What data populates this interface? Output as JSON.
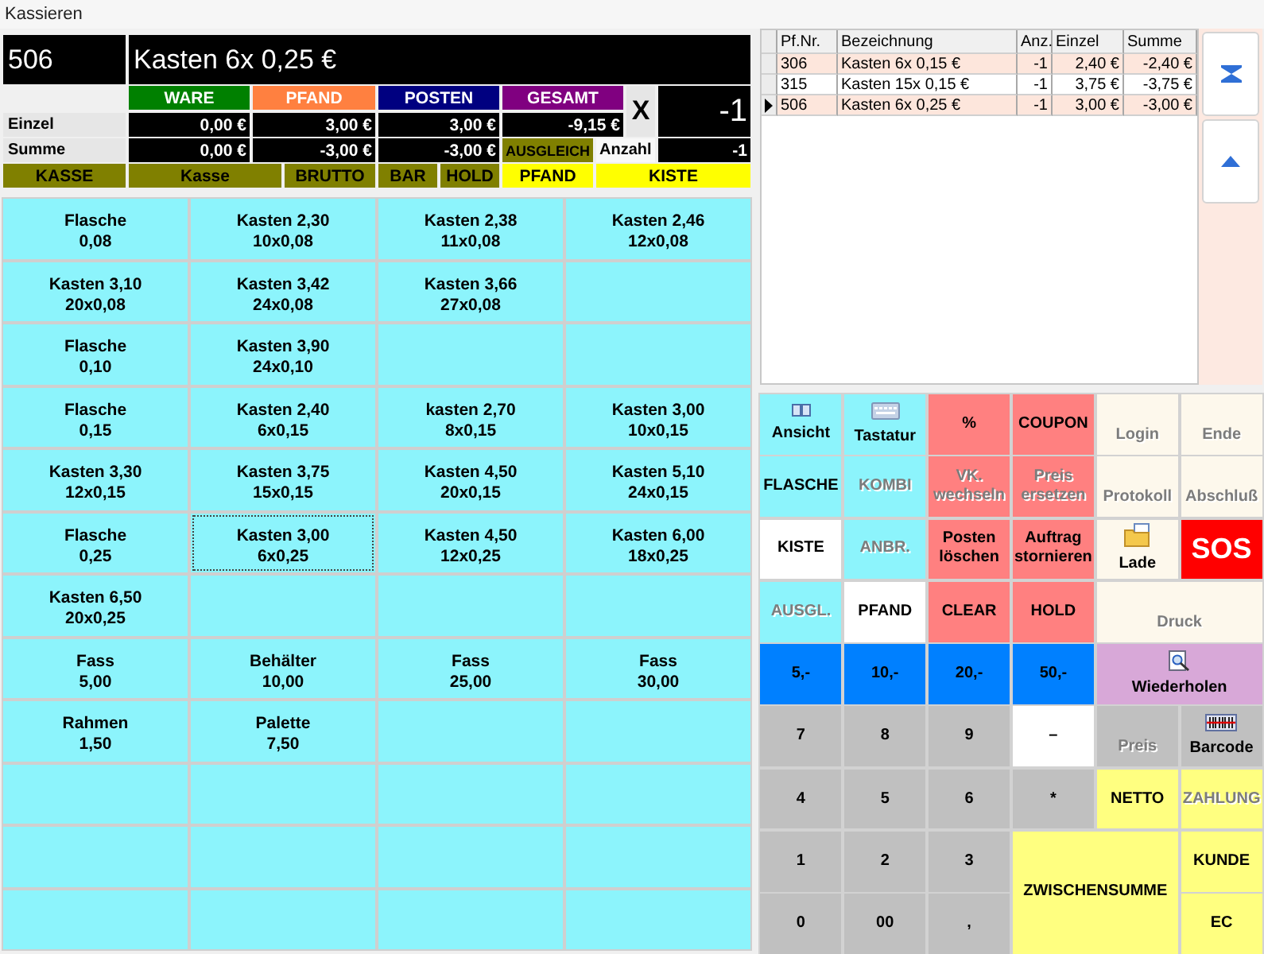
{
  "window": {
    "title": "Kassieren"
  },
  "display": {
    "code": "506",
    "text": "Kasten 6x 0,25 €"
  },
  "totals": {
    "columns": [
      {
        "label": "WARE",
        "color": "#008000"
      },
      {
        "label": "PFAND",
        "color": "#ff8040"
      },
      {
        "label": "POSTEN",
        "color": "#000080"
      },
      {
        "label": "GESAMT",
        "color": "#800080"
      }
    ],
    "rows": [
      {
        "label": "Einzel",
        "values": [
          "0,00 €",
          "3,00 €",
          "3,00 €",
          "-9,15 €"
        ]
      },
      {
        "label": "Summe",
        "values": [
          "0,00 €",
          "-3,00 €",
          "-3,00 €"
        ]
      }
    ],
    "multiply_sign": "X",
    "quantity": "-1",
    "balance_label": "AUSGLEICH",
    "count_label": "Anzahl",
    "count_value": "-1"
  },
  "status_bar": [
    {
      "label": "KASSE",
      "color": "#808000"
    },
    {
      "label": "Kasse",
      "color": "#808000"
    },
    {
      "label": "BRUTTO",
      "color": "#808000"
    },
    {
      "label": "BAR",
      "color": "#808000"
    },
    {
      "label": "HOLD",
      "color": "#808000"
    },
    {
      "label": "PFAND",
      "color": "#ffff00"
    },
    {
      "label": "KISTE",
      "color": "#ffff00"
    }
  ],
  "articles": [
    {
      "name": "Flasche",
      "detail": "0,08",
      "selected": false
    },
    {
      "name": "Kasten 2,30",
      "detail": "10x0,08",
      "selected": false
    },
    {
      "name": "Kasten 2,38",
      "detail": "11x0,08",
      "selected": false
    },
    {
      "name": "Kasten 2,46",
      "detail": "12x0,08",
      "selected": false
    },
    {
      "name": "Kasten 3,10",
      "detail": "20x0,08",
      "selected": false
    },
    {
      "name": "Kasten 3,42",
      "detail": "24x0,08",
      "selected": false
    },
    {
      "name": "Kasten 3,66",
      "detail": "27x0,08",
      "selected": false
    },
    {
      "selected": false
    },
    {
      "name": "Flasche",
      "detail": "0,10",
      "selected": false
    },
    {
      "name": "Kasten 3,90",
      "detail": "24x0,10",
      "selected": false
    },
    {
      "selected": false
    },
    {
      "selected": false
    },
    {
      "name": "Flasche",
      "detail": "0,15",
      "selected": false
    },
    {
      "name": "Kasten 2,40",
      "detail": "6x0,15",
      "selected": false
    },
    {
      "name": "kasten 2,70",
      "detail": "8x0,15",
      "selected": false
    },
    {
      "name": "Kasten 3,00",
      "detail": "10x0,15",
      "selected": false
    },
    {
      "name": "Kasten 3,30",
      "detail": "12x0,15",
      "selected": false
    },
    {
      "name": "Kasten 3,75",
      "detail": "15x0,15",
      "selected": false
    },
    {
      "name": "Kasten 4,50",
      "detail": "20x0,15",
      "selected": false
    },
    {
      "name": "Kasten 5,10",
      "detail": "24x0,15",
      "selected": false
    },
    {
      "name": "Flasche",
      "detail": "0,25",
      "selected": false
    },
    {
      "name": "Kasten 3,00",
      "detail": "6x0,25",
      "selected": true
    },
    {
      "name": "Kasten 4,50",
      "detail": "12x0,25",
      "selected": false
    },
    {
      "name": "Kasten 6,00",
      "detail": "18x0,25",
      "selected": false
    },
    {
      "name": "Kasten 6,50",
      "detail": "20x0,25",
      "selected": false
    },
    {
      "selected": false
    },
    {
      "selected": false
    },
    {
      "selected": false
    },
    {
      "name": "Fass",
      "detail": "5,00",
      "selected": false
    },
    {
      "name": "Behälter",
      "detail": "10,00",
      "selected": false
    },
    {
      "name": "Fass",
      "detail": "25,00",
      "selected": false
    },
    {
      "name": "Fass",
      "detail": "30,00",
      "selected": false
    },
    {
      "name": "Rahmen",
      "detail": "1,50",
      "selected": false
    },
    {
      "name": "Palette",
      "detail": "7,50",
      "selected": false
    },
    {
      "selected": false
    },
    {
      "selected": false
    },
    {
      "selected": false
    },
    {
      "selected": false
    },
    {
      "selected": false
    },
    {
      "selected": false
    },
    {
      "selected": false
    },
    {
      "selected": false
    },
    {
      "selected": false
    },
    {
      "selected": false
    },
    {
      "selected": false
    },
    {
      "selected": false
    },
    {
      "selected": false
    },
    {
      "selected": false
    }
  ],
  "table": {
    "columns": [
      "Pf.Nr.",
      "Bezeichnung",
      "Anz.",
      "Einzel",
      "Summe"
    ],
    "rows": [
      {
        "cells": [
          "306",
          "Kasten 6x 0,15 €",
          "-1",
          "2,40 €",
          "-2,40 €"
        ],
        "selected": false
      },
      {
        "cells": [
          "315",
          "Kasten 15x 0,15 €",
          "-1",
          "3,75 €",
          "-3,75 €"
        ],
        "selected": false
      },
      {
        "cells": [
          "506",
          "Kasten 6x 0,25 €",
          "-1",
          "3,00 €",
          "-3,00 €"
        ],
        "selected": true
      }
    ]
  },
  "keypad": [
    {
      "label": "Ansicht",
      "kind": "view",
      "color": "#8cf4fc",
      "disabled": false,
      "wide": false,
      "tall": false
    },
    {
      "label": "Tastatur",
      "kind": "keyboard",
      "color": "#8cf4fc",
      "disabled": false,
      "wide": false,
      "tall": false
    },
    {
      "label": "%",
      "kind": "text",
      "color": "#ff8080",
      "disabled": false,
      "wide": false,
      "tall": false
    },
    {
      "label": "COUPON",
      "kind": "text",
      "color": "#ff8080",
      "disabled": false,
      "wide": false,
      "tall": false
    },
    {
      "label": "Login",
      "kind": "low",
      "color": "#fdf8ec",
      "disabled": true,
      "wide": false,
      "tall": false
    },
    {
      "label": "Ende",
      "kind": "low",
      "color": "#fdf8ec",
      "disabled": true,
      "wide": false,
      "tall": false
    },
    {
      "label": "FLASCHE",
      "kind": "text",
      "color": "#8cf4fc",
      "disabled": false,
      "wide": false,
      "tall": false
    },
    {
      "label": "KOMBI",
      "kind": "text",
      "color": "#8cf4fc",
      "disabled": true,
      "wide": false,
      "tall": false
    },
    {
      "label": "VK. wechseln",
      "kind": "text",
      "color": "#ff8080",
      "disabled": true,
      "wide": false,
      "tall": false
    },
    {
      "label": "Preis ersetzen",
      "kind": "text",
      "color": "#ff8080",
      "disabled": true,
      "wide": false,
      "tall": false
    },
    {
      "label": "Protokoll",
      "kind": "low",
      "color": "#fdf8ec",
      "disabled": true,
      "wide": false,
      "tall": false
    },
    {
      "label": "Abschluß",
      "kind": "low",
      "color": "#fdf8ec",
      "disabled": true,
      "wide": false,
      "tall": false
    },
    {
      "label": "KISTE",
      "kind": "text",
      "color": "#ffffff",
      "disabled": false,
      "wide": false,
      "tall": false
    },
    {
      "label": "ANBR.",
      "kind": "text",
      "color": "#8cf4fc",
      "disabled": true,
      "wide": false,
      "tall": false
    },
    {
      "label": "Posten löschen",
      "kind": "text",
      "color": "#ff8080",
      "disabled": false,
      "wide": false,
      "tall": false
    },
    {
      "label": "Auftrag stornieren",
      "kind": "text",
      "color": "#ff8080",
      "disabled": false,
      "wide": false,
      "tall": false
    },
    {
      "label": "Lade",
      "kind": "folder",
      "color": "#fdf8ec",
      "disabled": false,
      "wide": false,
      "tall": false
    },
    {
      "label": "SOS",
      "kind": "alarm",
      "color": "#ff0000",
      "disabled": false,
      "wide": false,
      "tall": false
    },
    {
      "label": "AUSGL.",
      "kind": "text",
      "color": "#8cf4fc",
      "disabled": true,
      "wide": false,
      "tall": false
    },
    {
      "label": "PFAND",
      "kind": "text",
      "color": "#ffffff",
      "disabled": false,
      "wide": false,
      "tall": false
    },
    {
      "label": "CLEAR",
      "kind": "text",
      "color": "#ff8080",
      "disabled": false,
      "wide": false,
      "tall": false
    },
    {
      "label": "HOLD",
      "kind": "text",
      "color": "#ff8080",
      "disabled": false,
      "wide": false,
      "tall": false
    },
    {
      "label": "Druck",
      "kind": "low",
      "color": "#fdf8ec",
      "disabled": true,
      "wide": true,
      "tall": false
    },
    {
      "label": "5,-",
      "kind": "text",
      "color": "#0080ff",
      "disabled": false,
      "wide": false,
      "tall": false
    },
    {
      "label": "10,-",
      "kind": "text",
      "color": "#0080ff",
      "disabled": false,
      "wide": false,
      "tall": false
    },
    {
      "label": "20,-",
      "kind": "text",
      "color": "#0080ff",
      "disabled": false,
      "wide": false,
      "tall": false
    },
    {
      "label": "50,-",
      "kind": "text",
      "color": "#0080ff",
      "disabled": false,
      "wide": false,
      "tall": false
    },
    {
      "label": "Wiederholen",
      "kind": "reprint",
      "color": "#d8a8d8",
      "disabled": false,
      "wide": true,
      "tall": false
    },
    {
      "label": "7",
      "kind": "text",
      "color": "#c0c0c0",
      "disabled": false,
      "wide": false,
      "tall": false
    },
    {
      "label": "8",
      "kind": "text",
      "color": "#c0c0c0",
      "disabled": false,
      "wide": false,
      "tall": false
    },
    {
      "label": "9",
      "kind": "text",
      "color": "#c0c0c0",
      "disabled": false,
      "wide": false,
      "tall": false
    },
    {
      "label": "–",
      "kind": "text",
      "color": "#ffffff",
      "disabled": false,
      "wide": false,
      "tall": false
    },
    {
      "label": "Preis",
      "kind": "low",
      "color": "#c0c0c0",
      "disabled": true,
      "wide": false,
      "tall": false
    },
    {
      "label": "Barcode",
      "kind": "barcode",
      "color": "#c0c0c0",
      "disabled": false,
      "wide": false,
      "tall": false
    },
    {
      "label": "4",
      "kind": "text",
      "color": "#c0c0c0",
      "disabled": false,
      "wide": false,
      "tall": false
    },
    {
      "label": "5",
      "kind": "text",
      "color": "#c0c0c0",
      "disabled": false,
      "wide": false,
      "tall": false
    },
    {
      "label": "6",
      "kind": "text",
      "color": "#c0c0c0",
      "disabled": false,
      "wide": false,
      "tall": false
    },
    {
      "label": "*",
      "kind": "text",
      "color": "#c0c0c0",
      "disabled": false,
      "wide": false,
      "tall": false
    },
    {
      "label": "NETTO",
      "kind": "text",
      "color": "#ffff80",
      "disabled": false,
      "wide": false,
      "tall": false
    },
    {
      "label": "ZAHLUNG",
      "kind": "text",
      "color": "#ffff80",
      "disabled": true,
      "wide": false,
      "tall": false
    },
    {
      "label": "1",
      "kind": "text",
      "color": "#c0c0c0",
      "disabled": false,
      "wide": false,
      "tall": false
    },
    {
      "label": "2",
      "kind": "text",
      "color": "#c0c0c0",
      "disabled": false,
      "wide": false,
      "tall": false
    },
    {
      "label": "3",
      "kind": "text",
      "color": "#c0c0c0",
      "disabled": false,
      "wide": false,
      "tall": false
    },
    {
      "label": "ZWISCHENSUMME",
      "kind": "text",
      "color": "#ffff80",
      "disabled": false,
      "wide": true,
      "tall": true
    },
    {
      "label": "KUNDE",
      "kind": "text",
      "color": "#ffff80",
      "disabled": false,
      "wide": false,
      "tall": false
    },
    {
      "label": "0",
      "kind": "text",
      "color": "#c0c0c0",
      "disabled": false,
      "wide": false,
      "tall": false
    },
    {
      "label": "00",
      "kind": "text",
      "color": "#c0c0c0",
      "disabled": false,
      "wide": false,
      "tall": false
    },
    {
      "label": ",",
      "kind": "text",
      "color": "#c0c0c0",
      "disabled": false,
      "wide": false,
      "tall": false
    },
    {
      "label": "EC",
      "kind": "text",
      "color": "#ffff80",
      "disabled": false,
      "wide": false,
      "tall": false
    }
  ]
}
